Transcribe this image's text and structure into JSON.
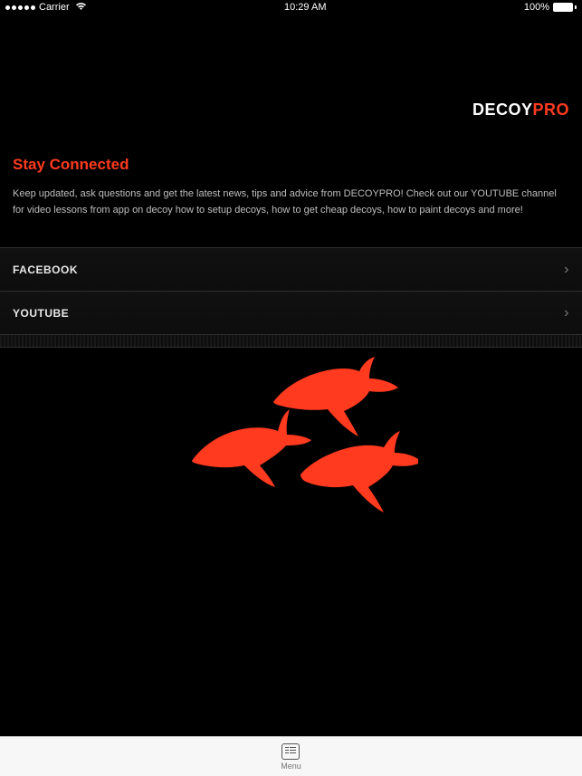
{
  "status": {
    "carrier": "Carrier",
    "time": "10:29 AM",
    "battery": "100%"
  },
  "brand": {
    "part1": "DECOY",
    "part2": "PRO"
  },
  "section": {
    "title": "Stay Connected",
    "description": "Keep updated, ask questions and get the latest news, tips and advice from DECOYPRO! Check out our YOUTUBE channel for video lessons from app on decoy how to setup decoys, how to get cheap decoys, how to paint decoys and more!"
  },
  "links": [
    {
      "label": "FACEBOOK"
    },
    {
      "label": "YOUTUBE"
    }
  ],
  "tabbar": {
    "menu": "Menu"
  },
  "colors": {
    "accent": "#ff3a1f"
  }
}
